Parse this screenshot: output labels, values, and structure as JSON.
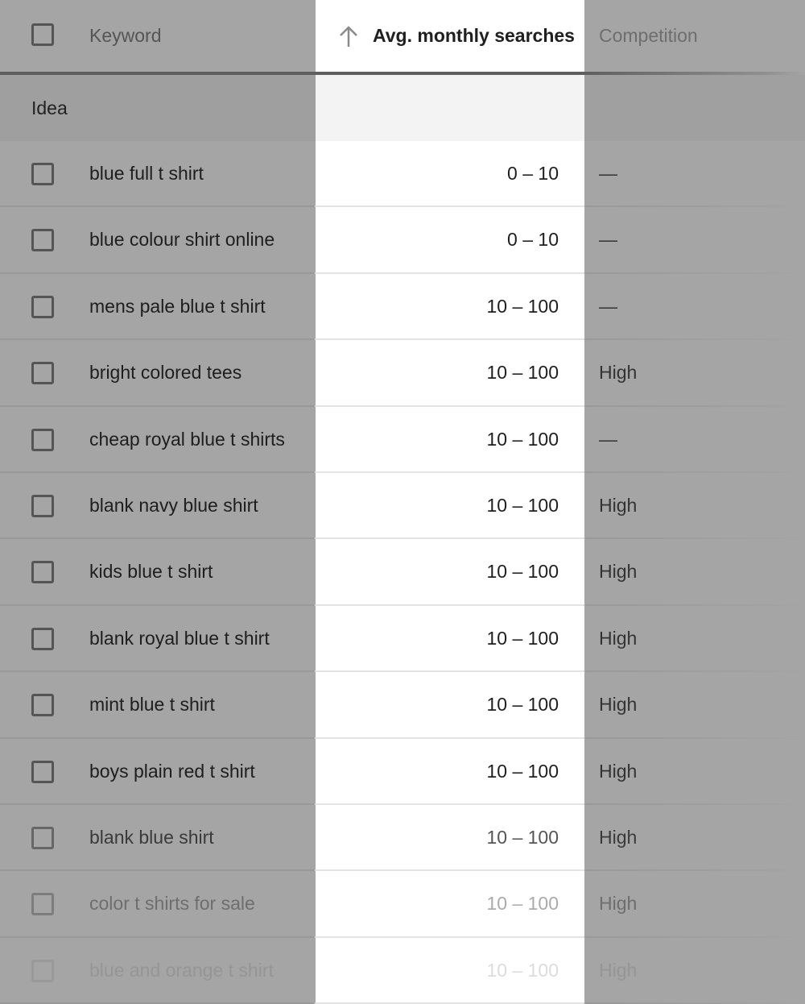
{
  "header": {
    "keyword_label": "Keyword",
    "avg_searches_label": "Avg. monthly searches",
    "competition_label": "Competition",
    "sort_icon": "arrow-up-icon",
    "sort_direction": "ascending"
  },
  "group": {
    "label": "Idea"
  },
  "rows": [
    {
      "keyword": "blue full t shirt",
      "avg": "0 – 10",
      "competition": "—"
    },
    {
      "keyword": "blue colour shirt online",
      "avg": "0 – 10",
      "competition": "—"
    },
    {
      "keyword": "mens pale blue t shirt",
      "avg": "10 – 100",
      "competition": "—"
    },
    {
      "keyword": "bright colored tees",
      "avg": "10 – 100",
      "competition": "High"
    },
    {
      "keyword": "cheap royal blue t shirts",
      "avg": "10 – 100",
      "competition": "—"
    },
    {
      "keyword": "blank navy blue shirt",
      "avg": "10 – 100",
      "competition": "High"
    },
    {
      "keyword": "kids blue t shirt",
      "avg": "10 – 100",
      "competition": "High"
    },
    {
      "keyword": "blank royal blue t shirt",
      "avg": "10 – 100",
      "competition": "High"
    },
    {
      "keyword": "mint blue t shirt",
      "avg": "10 – 100",
      "competition": "High"
    },
    {
      "keyword": "boys plain red t shirt",
      "avg": "10 – 100",
      "competition": "High"
    },
    {
      "keyword": "blank blue shirt",
      "avg": "10 – 100",
      "competition": "High"
    },
    {
      "keyword": "color t shirts for sale",
      "avg": "10 – 100",
      "competition": "High"
    },
    {
      "keyword": "blue and orange t shirt",
      "avg": "10 – 100",
      "competition": "High"
    }
  ]
}
